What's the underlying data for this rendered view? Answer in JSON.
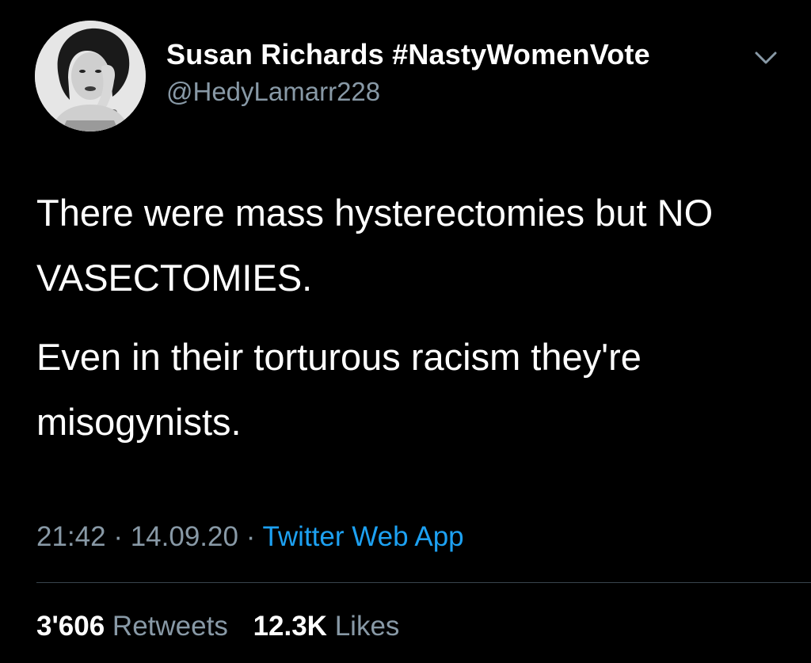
{
  "user": {
    "display_name": "Susan Richards #NastyWomenVote",
    "handle": "@HedyLamarr228",
    "avatar_icon": "profile-photo"
  },
  "tweet": {
    "paragraphs": [
      "There were mass hysterectomies but NO VASECTOMIES.",
      "Even in their torturous racism they're misogynists."
    ],
    "time": "21:42",
    "separator": "·",
    "date": "14.09.20",
    "source": "Twitter Web App"
  },
  "stats": {
    "retweets_count": "3'606",
    "retweets_label": "Retweets",
    "likes_count": "12.3K",
    "likes_label": "Likes"
  },
  "colors": {
    "background": "#000000",
    "text_primary": "#ffffff",
    "text_secondary": "#8899a6",
    "link": "#1da1f2",
    "divider": "#38444d"
  },
  "icons": {
    "menu": "chevron-down-icon"
  }
}
